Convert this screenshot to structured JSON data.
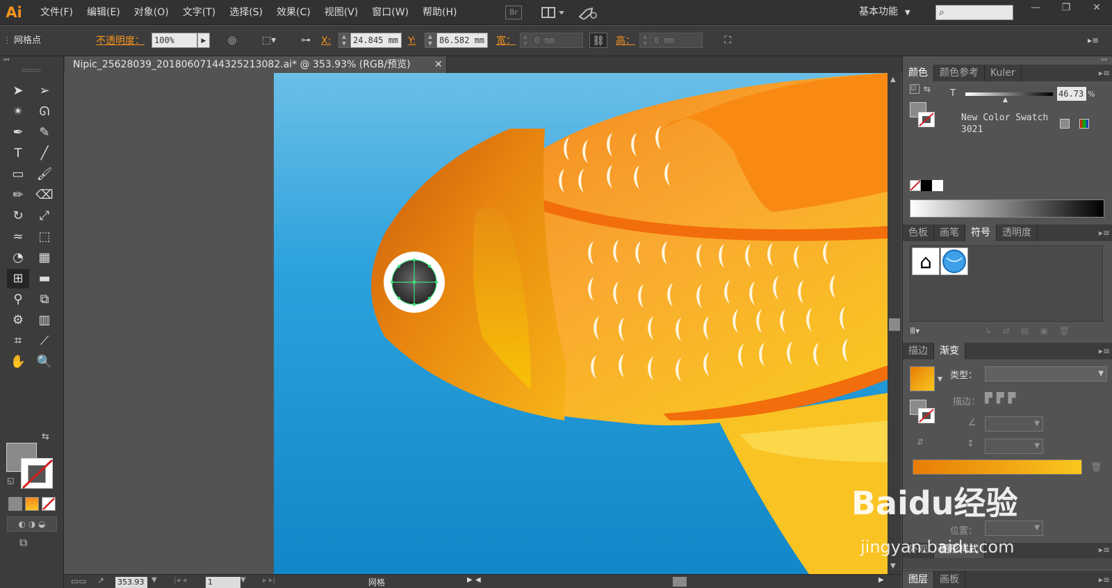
{
  "app": {
    "logo": "Ai",
    "workspace": "基本功能",
    "bridge": "Br"
  },
  "menu": [
    "文件(F)",
    "编辑(E)",
    "对象(O)",
    "文字(T)",
    "选择(S)",
    "效果(C)",
    "视图(V)",
    "窗口(W)",
    "帮助(H)"
  ],
  "control": {
    "selection_label": "网格点",
    "opacity_label": "不透明度：",
    "opacity_value": "100%",
    "x_label": "X:",
    "x_value": "24.845 mm",
    "y_label": "Y:",
    "y_value": "86.582 mm",
    "w_label": "宽：",
    "w_value": "0 mm",
    "h_label": "高：",
    "h_value": "0 mm"
  },
  "document": {
    "tab_title": "Nipic_25628039_20180607144325213082.ai* @ 353.93% (RGB/预览)"
  },
  "status": {
    "zoom": "353.93",
    "page": "1",
    "tool": "网格"
  },
  "panels": {
    "color": {
      "tabs": [
        "颜色",
        "颜色参考",
        "Kuler"
      ],
      "t_label": "T",
      "t_value": "46.73",
      "percent": "%",
      "swatch_name": "New Color Swatch 3021"
    },
    "symbols": {
      "tabs": [
        "色板",
        "画笔",
        "符号",
        "透明度"
      ]
    },
    "gradient": {
      "tabs": [
        "描边",
        "渐变"
      ],
      "type_label": "类型：",
      "stroke_label": "描边：",
      "position_label": "位置："
    },
    "appearance": {
      "tabs": [
        "外观",
        "图形样式"
      ]
    },
    "layers": {
      "tabs": [
        "图层",
        "画板"
      ]
    }
  },
  "watermark": {
    "line1": "Baidu经验",
    "line2": "jingyan.baidu.com"
  },
  "colors": {
    "accent": "#f7931e",
    "sky_top": "#6bbfe8",
    "sky_bottom": "#1287c9",
    "fish_orange": "#f58a1f",
    "fish_yellow": "#f9c323"
  }
}
